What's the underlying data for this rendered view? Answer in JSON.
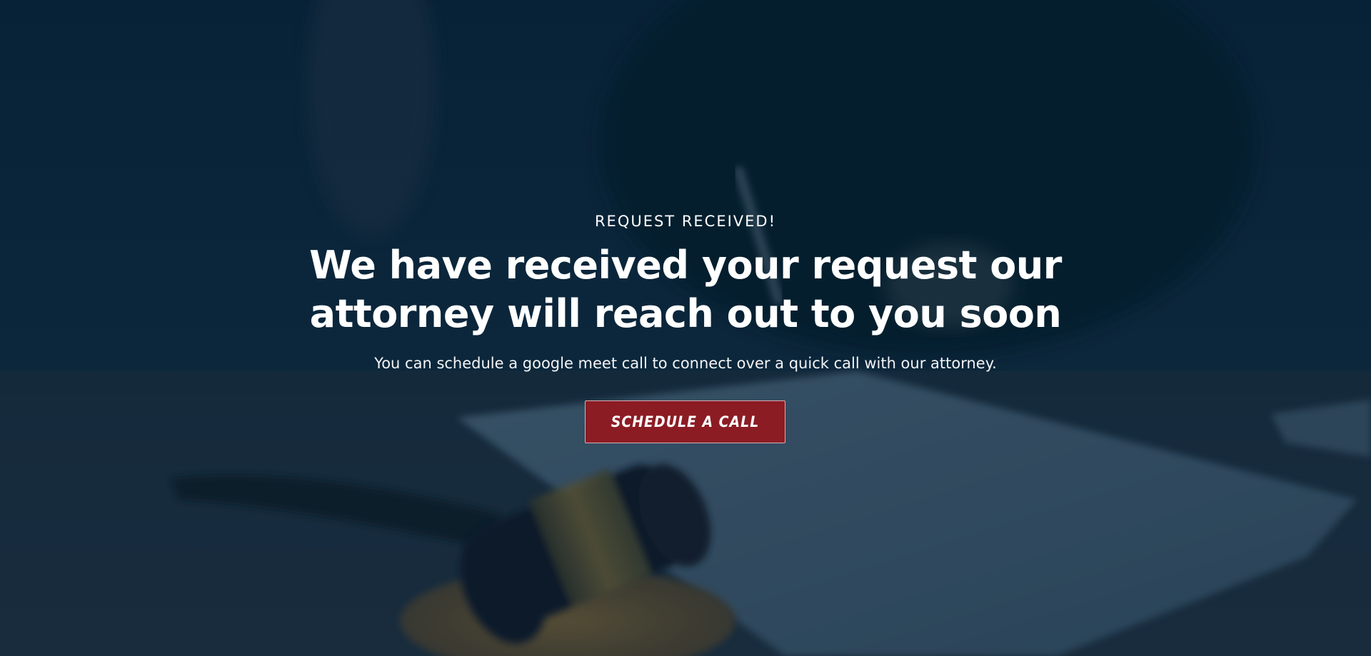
{
  "hero": {
    "eyebrow": "REQUEST RECEIVED!",
    "headline": "We have received your request our attorney will reach out to you soon",
    "subtext": "You can schedule a google meet call to connect over a quick call with our attorney.",
    "cta_label": "SCHEDULE A CALL"
  },
  "colors": {
    "overlay": "#0b2233",
    "cta_background": "#8c1c24",
    "text": "#ffffff"
  },
  "icons": {
    "background_image": "gavel-and-document-photo"
  }
}
